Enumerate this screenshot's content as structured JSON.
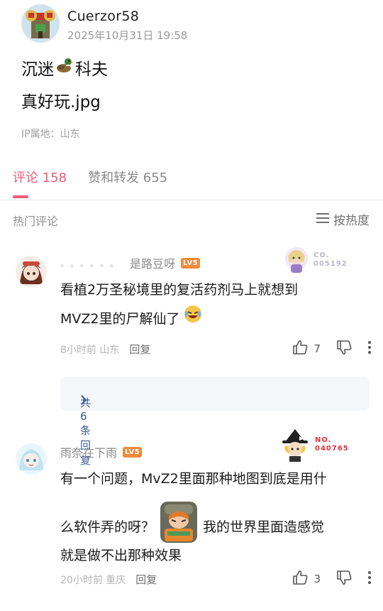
{
  "post": {
    "author": "Cuerzor58",
    "time": "2025年10月31日 19:58",
    "line1_before": "沉迷",
    "line1_emoji": "duck-emoji",
    "line1_after": "科夫",
    "line2": "真好玩.jpg",
    "ip": "IP属地：山东"
  },
  "tabs": [
    {
      "label": "评论 158",
      "active": true
    },
    {
      "label": "赞和转发 655",
      "active": false
    }
  ],
  "section": {
    "hot_label": "热门评论",
    "sort_label": "按热度"
  },
  "comments": [
    {
      "name_prefix": "。。。。。。",
      "name": "是路豆呀",
      "level": "LV5",
      "badge": "CO. 005192",
      "badge_line1": "CO.",
      "badge_line2": "005192",
      "text_line1": "看植2万圣秘境里的复活药剂马上就想到",
      "text_line2": "MVZ2里的尸解仙了",
      "time": "8小时前",
      "location": "山东",
      "reply_label": "回复",
      "likes": "7",
      "replies_label": "共6条回复"
    },
    {
      "name": "雨奈在下雨",
      "level": "LV5",
      "badge_line1": "NO.",
      "badge_line2": "040765",
      "text_line1": "有一个问题，MvZ2里面那种地图到底是用什",
      "text_line2a": "么软件弄的呀？",
      "text_line2b": "我的世界里面造感觉",
      "text_line3": "就是做不出那种效果",
      "time": "20小时前",
      "location": "重庆",
      "reply_label": "回复",
      "likes": "3"
    }
  ],
  "colors": {
    "accent": "#e85d7a",
    "level_badge": "#f08a3a",
    "link": "#3a5b92"
  }
}
